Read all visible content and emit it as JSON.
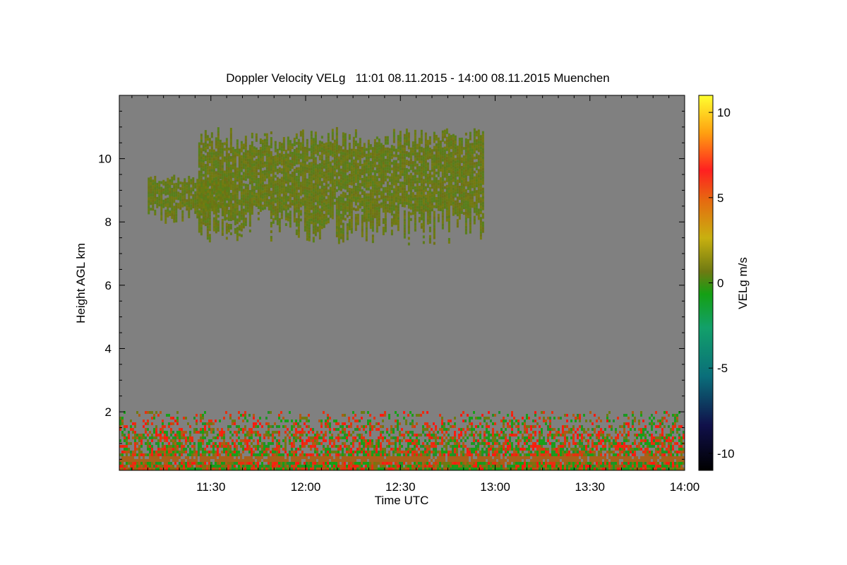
{
  "chart_data": {
    "type": "heatmap",
    "title": "Doppler Velocity VELg   11:01 08.11.2015 - 14:00 08.11.2015 Muenchen",
    "xlabel": "Time UTC",
    "ylabel": "Height AGL km",
    "x_range": [
      "11:01",
      "14:00"
    ],
    "ylim": [
      0.15,
      12.0
    ],
    "x_ticks": [
      "11:30",
      "12:00",
      "12:30",
      "13:00",
      "13:30",
      "14:00"
    ],
    "y_ticks": [
      2,
      4,
      6,
      8,
      10
    ],
    "colorbar": {
      "label": "VELg m/s",
      "range": [
        -11,
        11
      ],
      "ticks": [
        10,
        5,
        0,
        -5,
        -10
      ],
      "colors": [
        "#000000",
        "#10104a",
        "#0a6e7a",
        "#12a06a",
        "#14a014",
        "#6e7a12",
        "#c8b010",
        "#e66a10",
        "#ff2020",
        "#ffa010",
        "#ffff30"
      ]
    },
    "background_color": "#808080",
    "regions": [
      {
        "name": "upper cloud",
        "time": [
          "11:26",
          "12:56"
        ],
        "height_km": [
          7.3,
          11.0
        ],
        "velocity_ms": -0.5
      },
      {
        "name": "lower cloud layer",
        "time": [
          "11:10",
          "11:35"
        ],
        "height_km": [
          8.0,
          9.5
        ],
        "velocity_ms": -0.5
      },
      {
        "name": "boundary layer",
        "time": [
          "11:01",
          "14:00"
        ],
        "height_km": [
          0.15,
          2.0
        ],
        "velocity_ms": [
          -2,
          3
        ]
      }
    ]
  }
}
